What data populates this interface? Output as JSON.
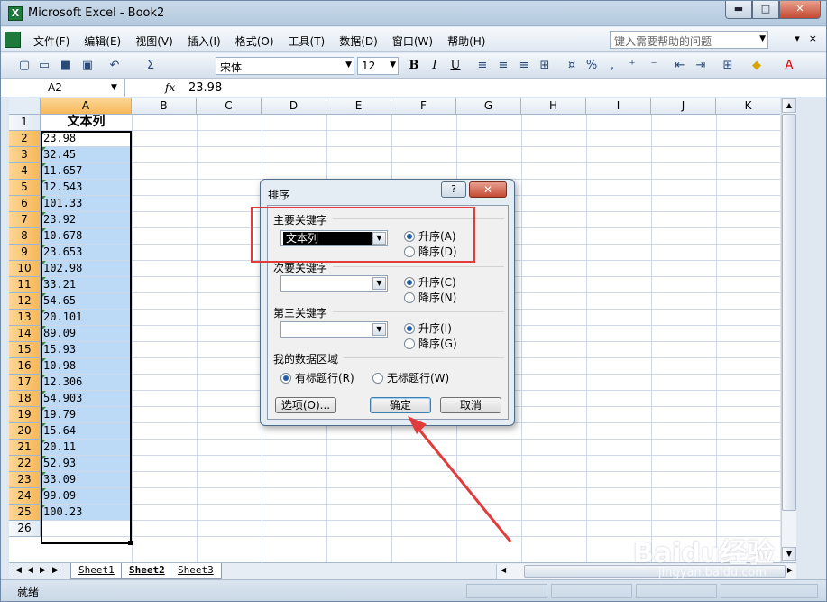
{
  "window": {
    "title": "Microsoft Excel - Book2",
    "app_icon_letter": "X"
  },
  "window_buttons": {
    "minimize": "▬",
    "maximize": "□",
    "close": "✕"
  },
  "menu": {
    "items": [
      "文件(F)",
      "编辑(E)",
      "视图(V)",
      "插入(I)",
      "格式(O)",
      "工具(T)",
      "数据(D)",
      "窗口(W)",
      "帮助(H)"
    ],
    "help_placeholder": "键入需要帮助的问题",
    "right_buttons": [
      "▾",
      "×"
    ]
  },
  "toolbar": {
    "font": "宋体",
    "size": "12",
    "bold": "B",
    "italic": "I",
    "underline": "U",
    "percent": "%",
    "comma": ","
  },
  "formula_bar": {
    "name_box": "A2",
    "fx": "fx",
    "value": "23.98"
  },
  "grid": {
    "columns": [
      "A",
      "B",
      "C",
      "D",
      "E",
      "F",
      "G",
      "H",
      "I",
      "J",
      "K"
    ],
    "rows": [
      "1",
      "2",
      "3",
      "4",
      "5",
      "6",
      "7",
      "8",
      "9",
      "10",
      "11",
      "12",
      "13",
      "14",
      "15",
      "16",
      "17",
      "18",
      "19",
      "20",
      "21",
      "22",
      "23",
      "24",
      "25",
      "26"
    ],
    "header_cell": "文本列",
    "values": [
      "23.98",
      "32.45",
      "11.657",
      "12.543",
      "101.33",
      "23.92",
      "10.678",
      "23.653",
      "102.98",
      "33.21",
      "54.65",
      "20.101",
      "89.09",
      "15.93",
      "10.98",
      "12.306",
      "54.903",
      "19.79",
      "15.64",
      "20.11",
      "52.93",
      "33.09",
      "99.09",
      "100.23"
    ]
  },
  "sheets": {
    "tabs": [
      "Sheet1",
      "Sheet2",
      "Sheet3"
    ],
    "nav": [
      "|◀",
      "◀",
      "▶",
      "▶|"
    ]
  },
  "status": {
    "text": "就绪"
  },
  "dialog": {
    "title": "排序",
    "help": "?",
    "close": "✕",
    "primary_label": "主要关键字",
    "primary_value": "文本列",
    "asc_a": "升序(A)",
    "desc_d": "降序(D)",
    "secondary_label": "次要关键字",
    "asc_c": "升序(C)",
    "desc_n": "降序(N)",
    "tertiary_label": "第三关键字",
    "asc_i": "升序(I)",
    "desc_g": "降序(G)",
    "range_label": "我的数据区域",
    "has_header": "有标题行(R)",
    "no_header": "无标题行(W)",
    "options_button": "选项(O)...",
    "ok_button": "确定",
    "cancel_button": "取消"
  },
  "watermark": {
    "text": "Baidu经验",
    "sub": "jingyan.baidu.com"
  },
  "colors": {
    "selection": "#bcd9f5",
    "header_selected": "#f6b85a",
    "annotation": "#e23b3b"
  }
}
